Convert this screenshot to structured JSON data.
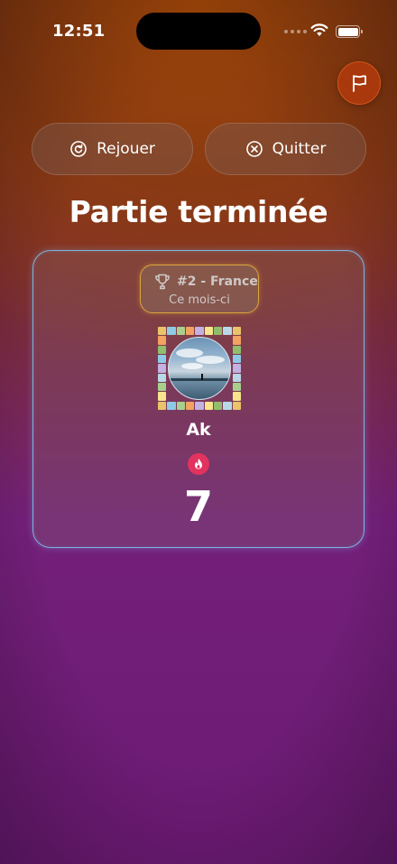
{
  "status_bar": {
    "time": "12:51"
  },
  "actions": {
    "replay_label": "Rejouer",
    "quit_label": "Quitter"
  },
  "title": "Partie terminée",
  "result": {
    "rank": "#2 - France",
    "period": "Ce mois-ci",
    "player_name": "Ak",
    "score": "7"
  },
  "colors": {
    "card_border": "#7ab6e0",
    "badge_border": "#d9a53a",
    "streak": "#e2325f",
    "flag_button": "#a9380c"
  },
  "icons": {
    "replay": "replay-icon",
    "quit": "close-circle-icon",
    "flag": "flag-icon",
    "trophy": "trophy-icon",
    "streak": "flame-icon"
  }
}
